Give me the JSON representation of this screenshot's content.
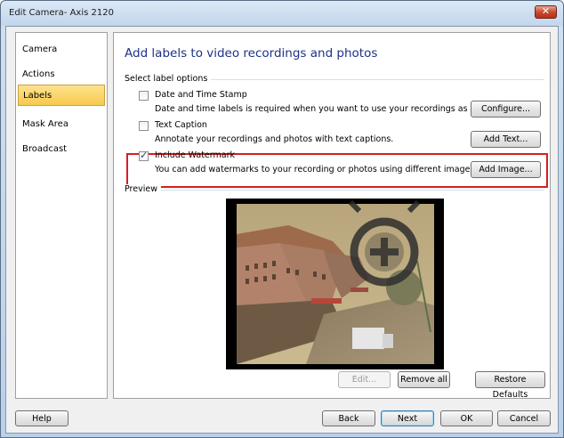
{
  "window": {
    "title": "Edit Camera- Axis 2120",
    "close_glyph": "✕"
  },
  "sidebar": {
    "items": [
      {
        "label": "Camera",
        "active": false
      },
      {
        "label": "Actions",
        "active": false
      },
      {
        "label": "Labels",
        "active": true
      },
      {
        "label": "Mask Area",
        "active": false
      },
      {
        "label": "Broadcast",
        "active": false
      }
    ]
  },
  "main": {
    "heading": "Add labels to video recordings and photos",
    "select_label_options": "Select label options",
    "options": [
      {
        "label": "Date and Time Stamp",
        "description": "Date and time labels is required when you want to use your recordings as legal proof.",
        "checked": false,
        "button": "Configure..."
      },
      {
        "label": "Text Caption",
        "description": "Annotate your recordings and photos with text captions.",
        "checked": false,
        "button": "Add Text..."
      },
      {
        "label": "Include Watermark",
        "description": "You can add watermarks to your recording or photos using different images.",
        "checked": true,
        "button": "Add Image..."
      }
    ],
    "preview_label": "Preview",
    "preview_buttons": {
      "edit": "Edit...",
      "remove_all": "Remove all",
      "restore_defaults": "Restore Defaults"
    }
  },
  "footer": {
    "help": "Help",
    "back": "Back",
    "next": "Next",
    "ok": "OK",
    "cancel": "Cancel"
  },
  "colors": {
    "heading": "#1e3287",
    "highlight_border": "#d41f1f",
    "active_nav": "#f7c94c"
  }
}
